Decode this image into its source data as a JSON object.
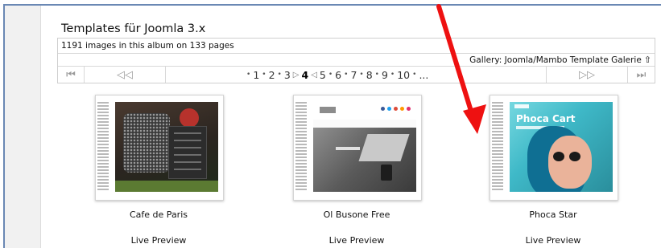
{
  "album": {
    "title": "Templates für Joomla 3.x",
    "image_count_text": "1191 images in this album on 133 pages",
    "gallery_link_text": "Gallery: Joomla/Mambo Template Galerie",
    "up_icon": "⇧"
  },
  "pager": {
    "first_icon": "⏮",
    "prev_icon": "◁◁",
    "next_icon": "▷▷",
    "last_icon": "⏭",
    "pages": [
      "1",
      "2",
      "3",
      "4",
      "5",
      "6",
      "7",
      "8",
      "9",
      "10"
    ],
    "current": "4",
    "ellipsis": "..."
  },
  "templates": [
    {
      "name": "Cafe de Paris",
      "preview": "Live Preview"
    },
    {
      "name": "Ol Busone Free",
      "preview": "Live Preview"
    },
    {
      "name": "Phoca Star",
      "preview": "Live Preview",
      "screenshot_title": "Phoca Cart"
    }
  ],
  "colors": {
    "annotation_arrow": "#ee1111",
    "frame": "#6a88b4"
  }
}
